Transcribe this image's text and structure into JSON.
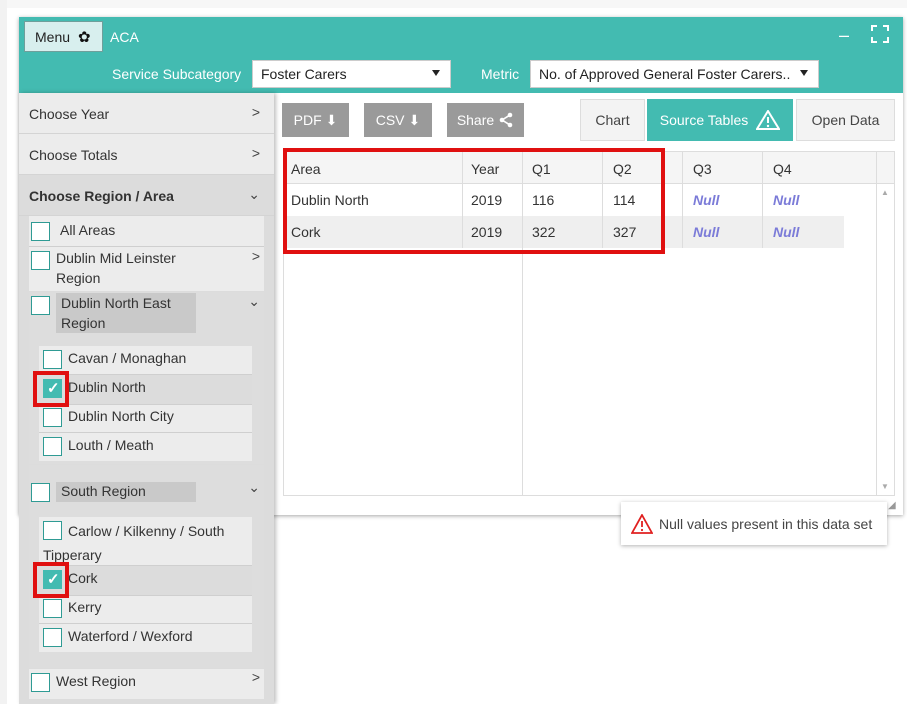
{
  "app": {
    "menu_label": "Menu",
    "title": "ACA",
    "minimize_glyph": "–"
  },
  "filters": {
    "subcategory_label": "Service Subcategory",
    "subcategory_value": "Foster Carers",
    "metric_label": "Metric",
    "metric_value": "No. of Approved General Foster Carers.."
  },
  "sidebar": {
    "choose_year": "Choose Year",
    "choose_totals": "Choose Totals",
    "choose_region": "Choose Region / Area",
    "all_areas": "All Areas",
    "dublin_mid_leinster": "Dublin Mid Leinster Region",
    "dublin_north_east": "Dublin North East Region",
    "dne_items": [
      {
        "label": "Cavan / Monaghan",
        "checked": false
      },
      {
        "label": "Dublin North",
        "checked": true
      },
      {
        "label": "Dublin North City",
        "checked": false
      },
      {
        "label": "Louth / Meath",
        "checked": false
      }
    ],
    "south_region": "South Region",
    "south_items": [
      {
        "label": "Carlow / Kilkenny / South Tipperary",
        "checked": false
      },
      {
        "label": "Cork",
        "checked": true
      },
      {
        "label": "Kerry",
        "checked": false
      },
      {
        "label": "Waterford / Wexford",
        "checked": false
      }
    ],
    "west_region": "West Region"
  },
  "toolbar": {
    "pdf": "PDF",
    "csv": "CSV",
    "share": "Share"
  },
  "tabs": {
    "chart": "Chart",
    "source_tables": "Source Tables",
    "open_data": "Open Data"
  },
  "table": {
    "headers": [
      "Area",
      "Year",
      "Q1",
      "Q2",
      "Q3",
      "Q4"
    ],
    "rows": [
      [
        "Dublin North",
        "2019",
        "116",
        "114",
        "Null",
        "Null"
      ],
      [
        "Cork",
        "2019",
        "322",
        "327",
        "Null",
        "Null"
      ]
    ]
  },
  "note": {
    "text": "Null values present in this data set"
  },
  "colors": {
    "accent": "#43bbb1",
    "highlight": "#e01010",
    "null_text": "#7b7bd8"
  }
}
